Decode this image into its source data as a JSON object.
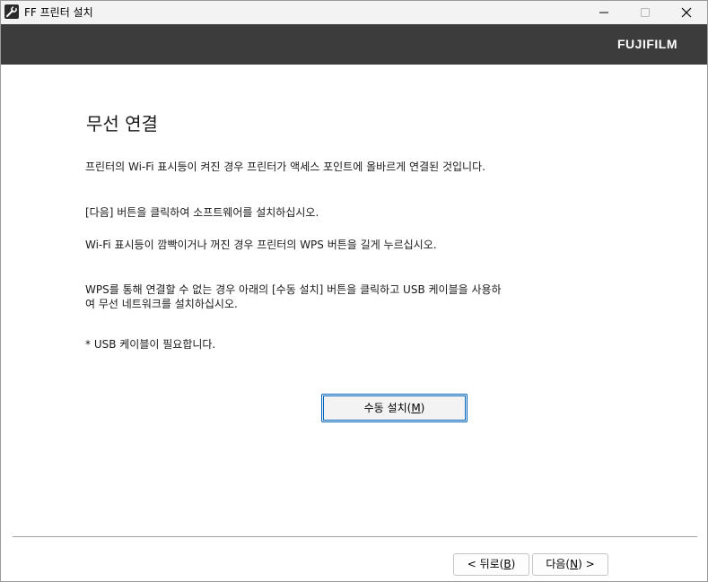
{
  "window": {
    "title": "FF 프린터 설치"
  },
  "brand": {
    "logo_text": "FUJIFILM"
  },
  "page": {
    "heading": "무선 연결",
    "p1": "프린터의 Wi-Fi 표시등이 켜진 경우 프린터가 액세스 포인트에 올바르게 연결된 것입니다.",
    "p2": "[다음] 버튼을 클릭하여 소프트웨어를 설치하십시오.",
    "p3": "Wi-Fi 표시등이 깜빡이거나 꺼진 경우 프린터의 WPS 버튼을 길게 누르십시오.",
    "p4_line1": "WPS를 통해 연결할 수 없는 경우 아래의 [수동 설치] 버튼을 클릭하고 USB 케이블을 사용하",
    "p4_line2": "여 무선 네트워크를 설치하십시오.",
    "p5": "* USB 케이블이 필요합니다."
  },
  "buttons": {
    "manual_prefix": "수동 설치(",
    "manual_key": "M",
    "manual_suffix": ")",
    "back_prefix": "< 뒤로(",
    "back_key": "B",
    "back_suffix": ")",
    "next_prefix": "다음(",
    "next_key": "N",
    "next_suffix": ") >"
  },
  "colors": {
    "brand_bar": "#3c3c3c",
    "focus_border": "#0067c0"
  }
}
